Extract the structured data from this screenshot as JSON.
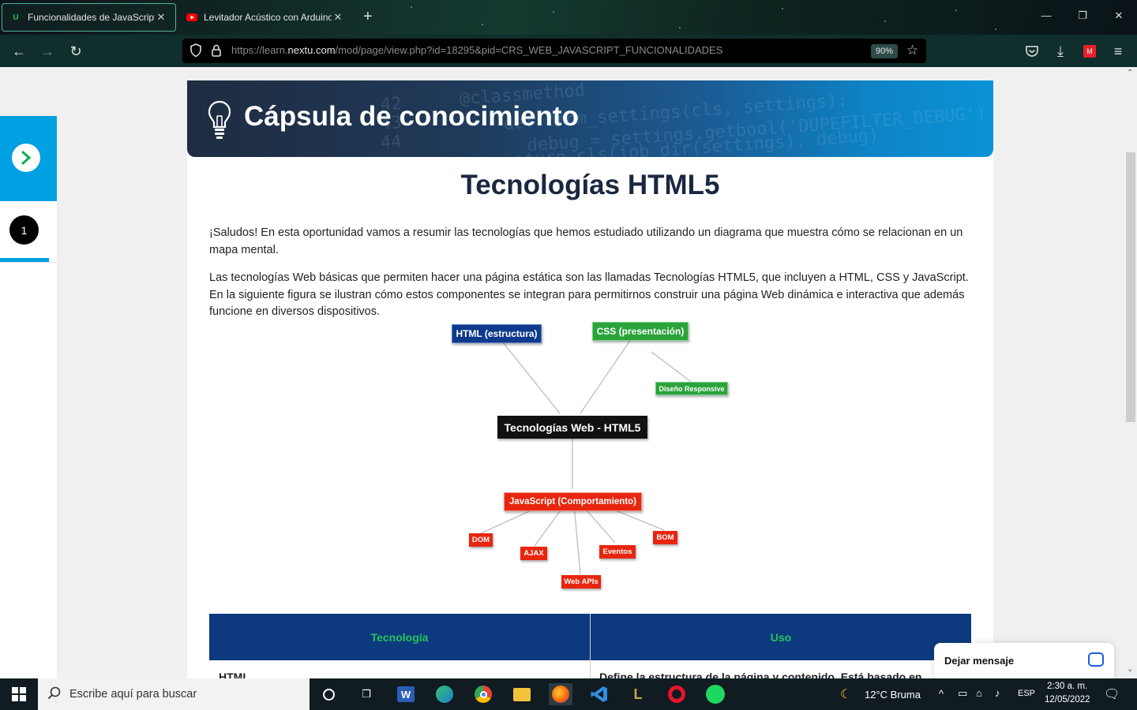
{
  "browser": {
    "tabs": [
      {
        "title": "Funcionalidades de JavaScript: ",
        "active": true,
        "favicon": "nextu-icon"
      },
      {
        "title": "Levitador Acústico con Arduino ",
        "active": false,
        "favicon": "youtube-icon"
      }
    ],
    "url_prefix": "https://learn.",
    "url_domain": "nextu.com",
    "url_path": "/mod/page/view.php?id=18295&pid=CRS_WEB_JAVASCRIPT_FUNCIONALIDADES",
    "zoom": "90%"
  },
  "sidebar": {
    "page_number": "1"
  },
  "banner": {
    "title": "Cápsula de conocimiento",
    "code_lines": [
      "@classmethod",
      "def from_settings(cls, settings):",
      "debug = settings.getbool('DUPEFILTER_DEBUG')",
      "return cls(job_dir(settings), debug)"
    ],
    "line_numbers": [
      "42",
      "43",
      "44"
    ]
  },
  "content": {
    "title": "Tecnologías HTML5",
    "paragraph1": "¡Saludos! En esta oportunidad vamos a resumir las tecnologías que hemos estudiado utilizando un diagrama que muestra cómo se relacionan en un mapa mental.",
    "paragraph2": "Las tecnologías Web básicas que permiten hacer una página estática son las llamadas Tecnologías HTML5, que incluyen a HTML, CSS y JavaScript. En la siguiente figura se ilustran cómo estos componentes se integran para permitirnos construir una página Web dinámica e interactiva que además funcione en diversos dispositivos."
  },
  "mindmap": {
    "center": "Tecnologías Web - HTML5",
    "html": "HTML (estructura)",
    "css": "CSS (presentación)",
    "responsive": "Diseño Responsive",
    "js": "JavaScript (Comportamiento)",
    "dom": "DOM",
    "ajax": "AJAX",
    "webapis": "Web APIs",
    "eventos": "Eventos",
    "bom": "BOM",
    "colors": {
      "html": "#0d3a8c",
      "css": "#2aa33a",
      "js": "#e8260f",
      "center": "#111111"
    }
  },
  "table": {
    "headers": [
      "Tecnología",
      "Uso"
    ],
    "row1": [
      "HTML",
      "Define la estructura de la página y contenido. Está basado en"
    ]
  },
  "chat": {
    "label": "Dejar mensaje"
  },
  "taskbar": {
    "search_placeholder": "Escribe aquí para buscar",
    "weather": "12°C  Bruma",
    "lang": "ESP",
    "time": "2:30 a. m.",
    "date": "12/05/2022"
  }
}
